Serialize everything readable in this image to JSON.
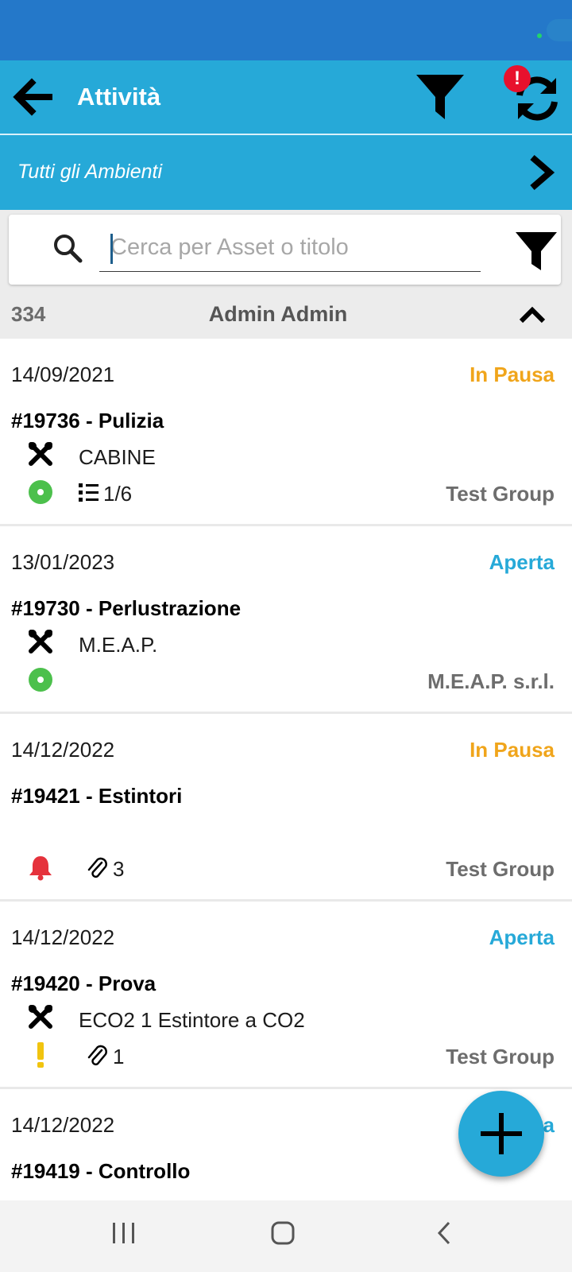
{
  "app_bar": {
    "title": "Attività",
    "notification_badge": "!"
  },
  "environment": {
    "label": "Tutti gli Ambienti"
  },
  "search": {
    "placeholder": "Cerca per Asset o titolo",
    "value": ""
  },
  "group": {
    "count": "334",
    "name": "Admin Admin"
  },
  "colors": {
    "primary": "#26a9d8",
    "status_paused": "#f0a51b",
    "status_open": "#26a9d8",
    "indicator_green": "#4cc04c",
    "indicator_red": "#e5323c",
    "indicator_yellow": "#f1c40f"
  },
  "items": [
    {
      "date": "14/09/2021",
      "status": "In Pausa",
      "status_color": "#f0a51b",
      "title": "#19736 - Pulizia",
      "asset": "CABINE",
      "indicator": "green-dot-icon",
      "meta_icon": "checklist-icon",
      "meta": "1/6",
      "group": "Test Group"
    },
    {
      "date": "13/01/2023",
      "status": "Aperta",
      "status_color": "#26a9d8",
      "title": "#19730 - Perlustrazione",
      "asset": "M.E.A.P.",
      "indicator": "green-dot-icon",
      "meta_icon": "",
      "meta": "",
      "group": "M.E.A.P. s.r.l."
    },
    {
      "date": "14/12/2022",
      "status": "In Pausa",
      "status_color": "#f0a51b",
      "title": "#19421 - Estintori",
      "asset": "",
      "indicator": "bell-icon",
      "meta_icon": "paperclip-icon",
      "meta": "3",
      "group": "Test Group"
    },
    {
      "date": "14/12/2022",
      "status": "Aperta",
      "status_color": "#26a9d8",
      "title": "#19420 - Prova",
      "asset": "ECO2 1 Estintore a CO2",
      "indicator": "exclamation-icon",
      "meta_icon": "paperclip-icon",
      "meta": "1",
      "group": "Test Group"
    },
    {
      "date": "14/12/2022",
      "status": "Aperta",
      "status_color": "#26a9d8",
      "title": "#19419 - Controllo",
      "asset": "",
      "indicator": "",
      "meta_icon": "",
      "meta": "",
      "group": ""
    }
  ]
}
